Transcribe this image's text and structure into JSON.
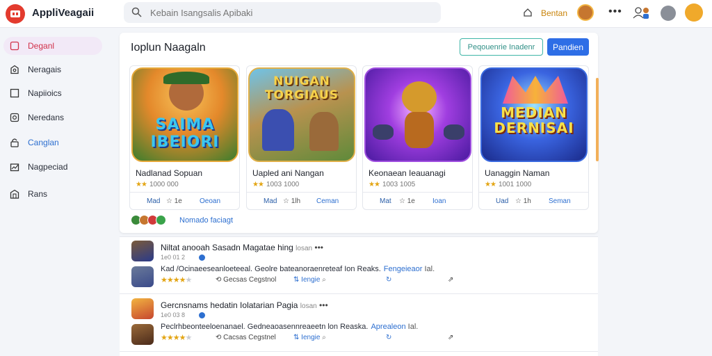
{
  "app": {
    "title": "AppliVeagaii"
  },
  "search": {
    "placeholder": "Kebain Isangsalis Apibaki"
  },
  "topbar": {
    "link_label": "Bentan"
  },
  "sidebar": {
    "items": [
      {
        "label": "Deganl",
        "icon": "heart-icon"
      },
      {
        "label": "Neragais",
        "icon": "gift-icon"
      },
      {
        "label": "Napiioics",
        "icon": "square-icon"
      },
      {
        "label": "Neredans",
        "icon": "circle-icon"
      },
      {
        "label": "Canglan",
        "icon": "lock-icon"
      },
      {
        "label": "Nagpeciad",
        "icon": "chart-icon"
      },
      {
        "label": "Rans",
        "icon": "building-icon"
      }
    ]
  },
  "panel": {
    "title": "Ioplun Naagaln",
    "outline_button": "Peqouenrie Inadenr",
    "primary_button": "Pandien",
    "cards": [
      {
        "art_title": "SAIMA IBEIORI",
        "name": "Nadlanad Sopuan",
        "rating_text": "1000 000",
        "actions": [
          "Mad",
          "☆ 1e",
          "Oeoan"
        ]
      },
      {
        "art_title": "NUIGAN TORGIAUS",
        "name": "Uapled ani Nangan",
        "rating_text": "1003 1000",
        "actions": [
          "Mad",
          "☆ 1lh",
          "Ceman"
        ]
      },
      {
        "art_title": "",
        "name": "Keonaean Ieauanagi",
        "rating_text": "1003 1005",
        "actions": [
          "Mat",
          "☆ 1e",
          "Ioan"
        ]
      },
      {
        "art_title": "MEDIAN DERNISAI",
        "name": "Uanaggin Naman",
        "rating_text": "1001 1000",
        "actions": [
          "Uad",
          "☆ 1h",
          "Seman"
        ]
      }
    ],
    "friends_label": "Nomado faciagt"
  },
  "feed": {
    "posts": [
      {
        "title": "Niltat anooah Sasadn Magatae hing",
        "title_suffix": "losan",
        "meta": "1e0 01 2",
        "body": "Kad /Ocinaeeseanloeteeal. Geolre bateanoraenreteaf Ion Reaks.",
        "link": "Fengeieaor",
        "link_suffix": "Ial.",
        "actions": [
          "Gecsas Cegstnol",
          "Iengie",
          "",
          ""
        ]
      },
      {
        "title": "Gercnsnams hedatin Iolatarian Pagia",
        "title_suffix": "losan",
        "meta": "1e0 03 8",
        "body": "Peclrhbeonteeloenanael. Gedneaoasennreaeetn lon Reaska.",
        "link": "Aprealeon",
        "link_suffix": "Ial.",
        "actions": [
          "Cacsas Cegstnel",
          "Iengie",
          "",
          ""
        ]
      }
    ]
  },
  "colors": {
    "accent": "#2e6ee6",
    "brand": "#e33b2e",
    "active_nav": "#d1314a",
    "star": "#e3a514"
  }
}
